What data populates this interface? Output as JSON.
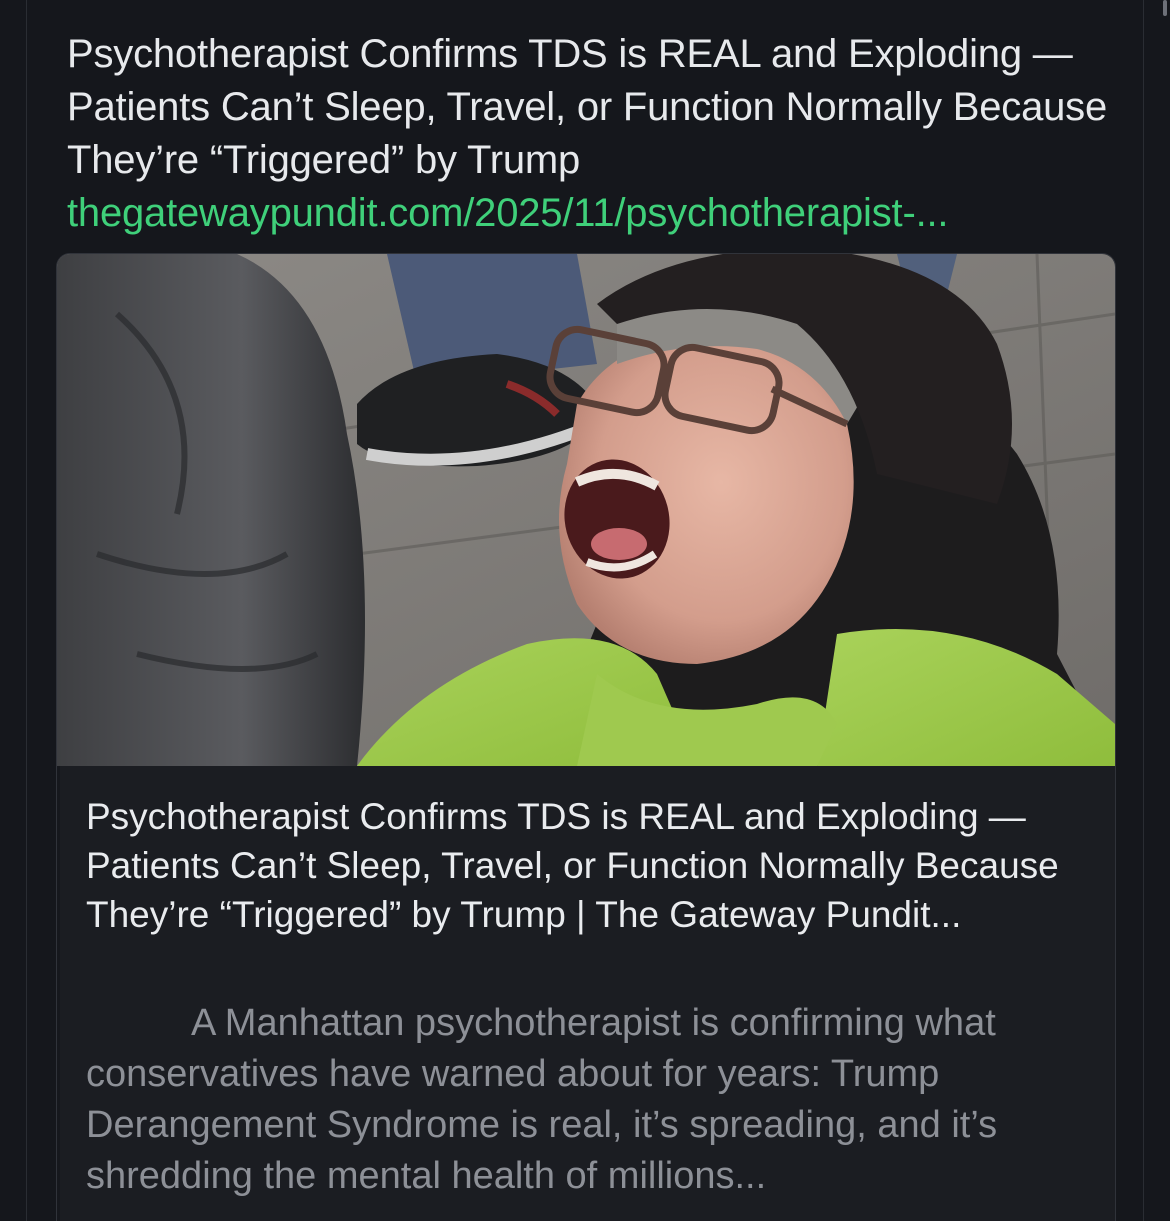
{
  "post": {
    "title": "Psychotherapist Confirms TDS is REAL and Exploding — Patients Can’t Sleep, Travel, or Function Normally Because They’re “Triggered” by Trump",
    "link_text": "thegatewaypundit.com/2025/11/psychotherapist-..."
  },
  "link_card": {
    "image_icon": "photo-of-screaming-protester",
    "title": "Psychotherapist Confirms TDS is REAL and Exploding — Patients Can’t Sleep, Travel, or Function Normally Because They’re “Triggered” by Trump | The Gateway Pundit...",
    "description": "A Manhattan psychotherapist is confirming what conservatives have warned about for years: Trump Derangement Syndrome is real, it’s spreading, and it’s shredding the mental health of millions..."
  },
  "colors": {
    "background": "#15171c",
    "text": "#e7e9ec",
    "link": "#3fd07a",
    "muted_text": "#8d9097"
  }
}
